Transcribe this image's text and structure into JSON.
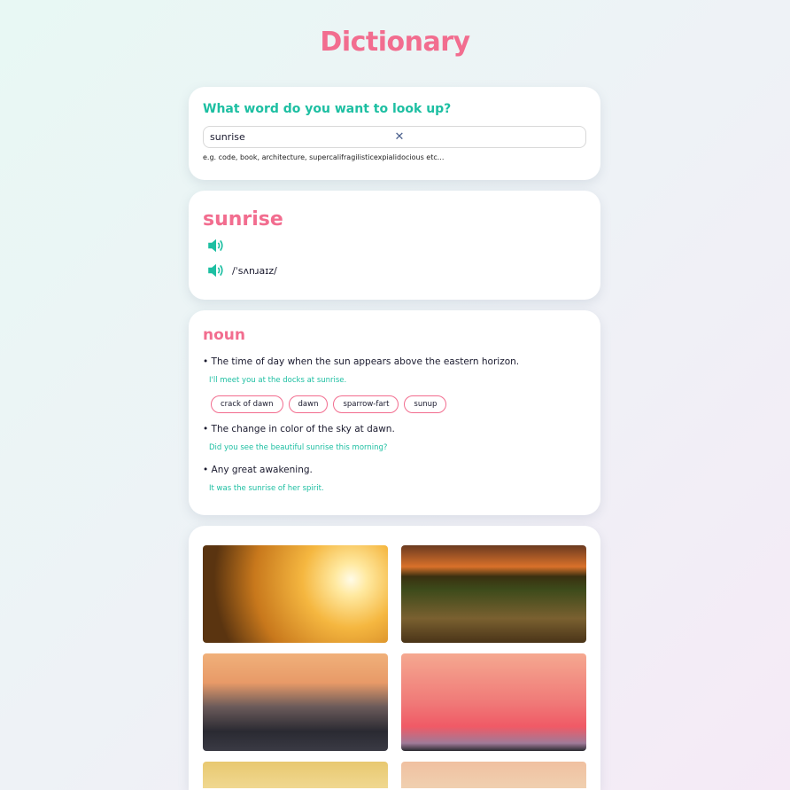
{
  "header": {
    "title": "Dictionary"
  },
  "search": {
    "prompt": "What word do you want to look up?",
    "value": "sunrise",
    "hint": "e.g. code, book, architecture, supercalifragilisticexpialidocious etc..."
  },
  "word": {
    "title": "sunrise",
    "phonetics": [
      {
        "text": ""
      },
      {
        "text": "/ˈsʌnɹaɪz/"
      }
    ]
  },
  "meaning": {
    "part_of_speech": "noun",
    "definitions": [
      {
        "text": "The time of day when the sun appears above the eastern horizon.",
        "example": "I'll meet you at the docks at sunrise.",
        "synonyms": [
          "crack of dawn",
          "dawn",
          "sparrow-fart",
          "sunup"
        ]
      },
      {
        "text": "The change in color of the sky at dawn.",
        "example": "Did you see the beautiful sunrise this morning?"
      },
      {
        "text": "Any great awakening.",
        "example": "It was the sunrise of her spirit."
      }
    ]
  },
  "colors": {
    "accent_pink": "#f26d8f",
    "accent_teal": "#1dbfa2"
  }
}
